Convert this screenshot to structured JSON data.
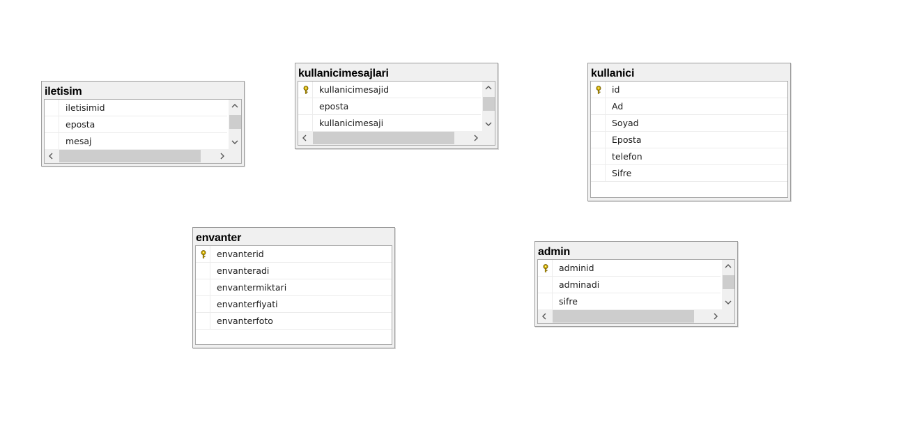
{
  "tables": {
    "iletisim": {
      "title": "iletisim",
      "columns": [
        {
          "name": "iletisimid",
          "key": false
        },
        {
          "name": "eposta",
          "key": false
        },
        {
          "name": "mesaj",
          "key": false
        }
      ]
    },
    "kullanicimesajlari": {
      "title": "kullanicimesajlari",
      "columns": [
        {
          "name": "kullanicimesajid",
          "key": true
        },
        {
          "name": "eposta",
          "key": false
        },
        {
          "name": "kullanicimesaji",
          "key": false
        }
      ]
    },
    "kullanici": {
      "title": "kullanici",
      "columns": [
        {
          "name": "id",
          "key": true
        },
        {
          "name": "Ad",
          "key": false
        },
        {
          "name": "Soyad",
          "key": false
        },
        {
          "name": "Eposta",
          "key": false
        },
        {
          "name": "telefon",
          "key": false
        },
        {
          "name": "Sifre",
          "key": false
        }
      ]
    },
    "envanter": {
      "title": "envanter",
      "columns": [
        {
          "name": "envanterid",
          "key": true
        },
        {
          "name": "envanteradi",
          "key": false
        },
        {
          "name": "envantermiktari",
          "key": false
        },
        {
          "name": "envanterfiyati",
          "key": false
        },
        {
          "name": "envanterfoto",
          "key": false
        }
      ]
    },
    "admin": {
      "title": "admin",
      "columns": [
        {
          "name": "adminid",
          "key": true
        },
        {
          "name": "adminadi",
          "key": false
        },
        {
          "name": "sifre",
          "key": false
        }
      ]
    }
  },
  "icons": {
    "key": "primary-key-icon",
    "key_color": "#d4b000"
  }
}
